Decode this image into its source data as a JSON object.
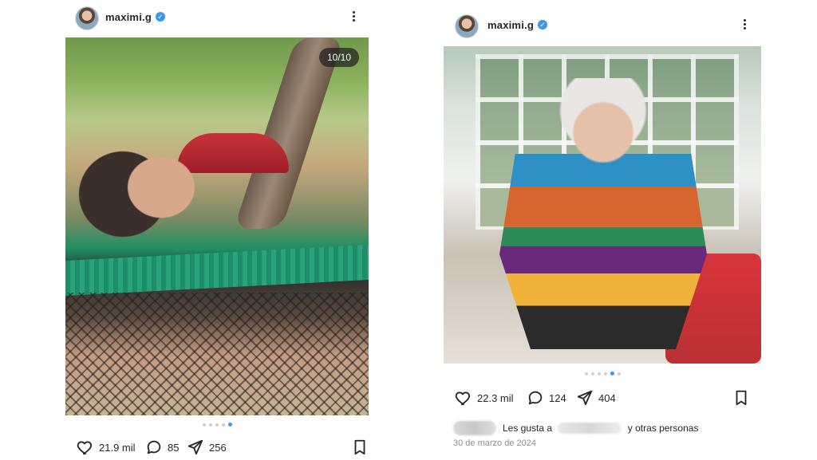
{
  "posts": [
    {
      "username": "maximi.g",
      "verified": true,
      "carousel_badge": "10/10",
      "carousel": {
        "count": 5,
        "active_index": 4
      },
      "likes": "21.9 mil",
      "comments": "85",
      "shares": "256"
    },
    {
      "username": "maximi.g",
      "verified": true,
      "carousel": {
        "count": 6,
        "active_index": 4
      },
      "likes": "22.3 mil",
      "comments": "124",
      "shares": "404",
      "liked_by_prefix": "Les gusta a",
      "liked_by_suffix": "y otras personas",
      "date": "30 de marzo de 2024"
    }
  ],
  "colors": {
    "text": "#262626",
    "muted": "#8e8e8e",
    "accent": "#3897f0"
  },
  "icons": {
    "verified": "verified-badge-icon",
    "more": "more-vertical-icon",
    "like": "heart-outline-icon",
    "comment": "comment-bubble-icon",
    "share": "paper-plane-icon",
    "save": "bookmark-outline-icon"
  }
}
